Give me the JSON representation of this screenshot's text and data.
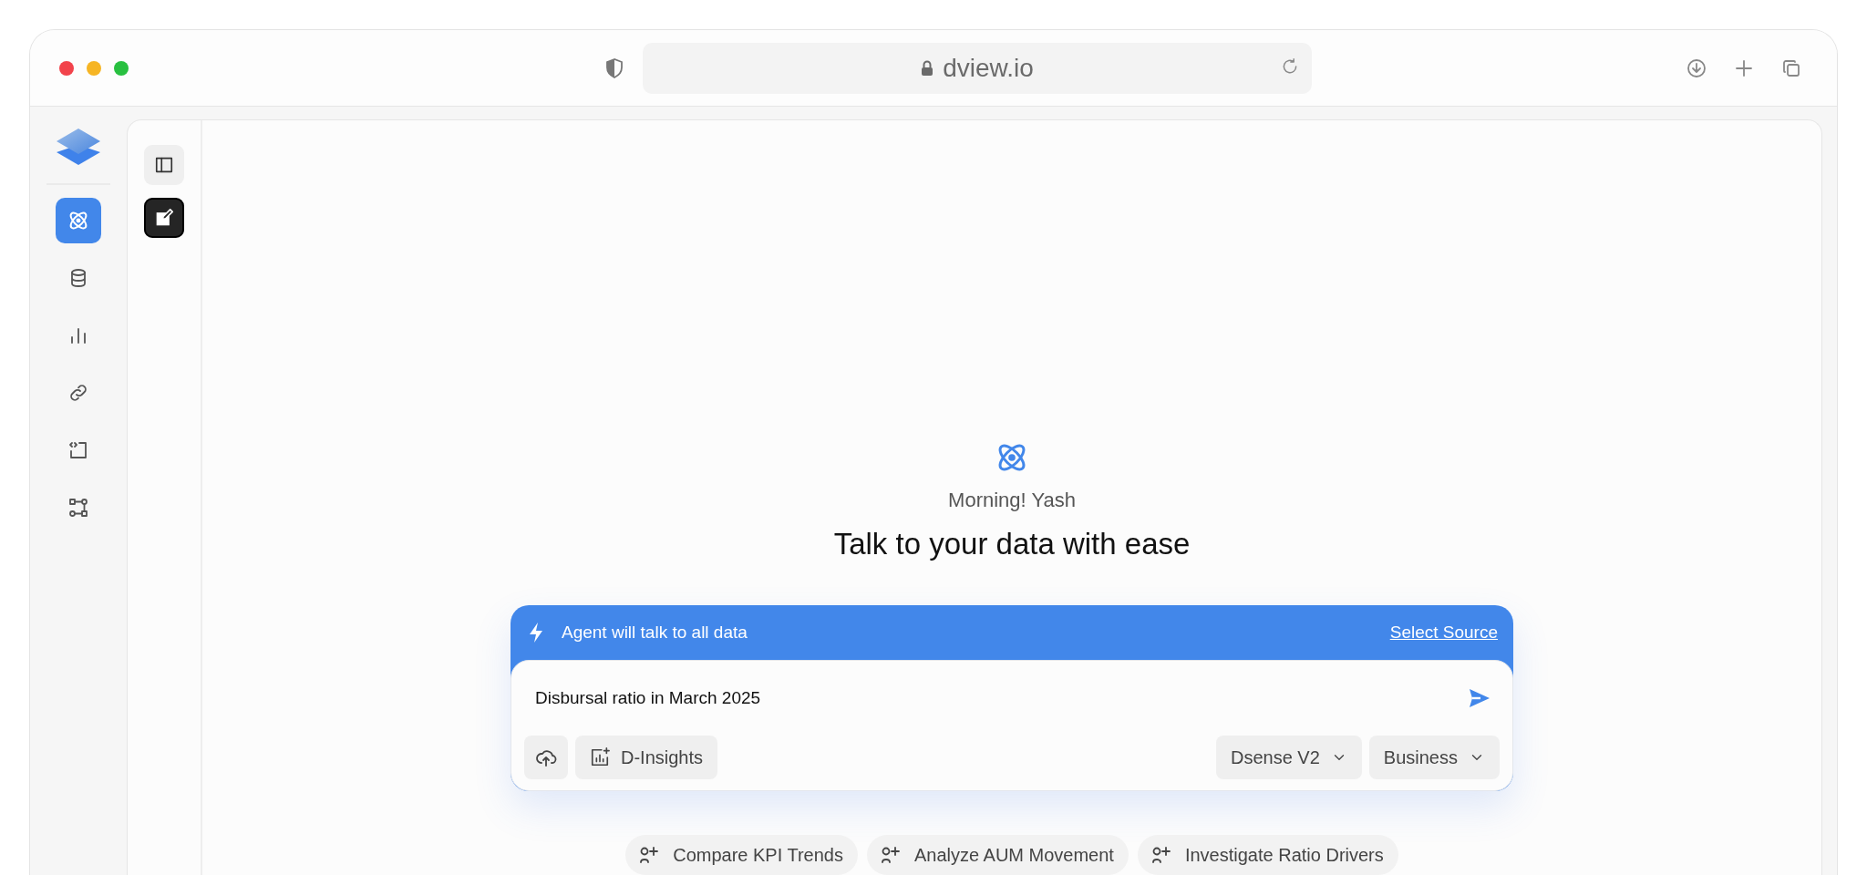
{
  "browser": {
    "url": "dview.io"
  },
  "nav": {
    "items": [
      {
        "kind": "atom",
        "selected": true
      },
      {
        "kind": "database",
        "selected": false
      },
      {
        "kind": "chart",
        "selected": false
      },
      {
        "kind": "link",
        "selected": false
      },
      {
        "kind": "code",
        "selected": false
      },
      {
        "kind": "flow",
        "selected": false
      }
    ]
  },
  "greeting": "Morning! Yash",
  "headline": "Talk to your data with ease",
  "composer": {
    "banner": "Agent will talk to all data",
    "source_link": "Select Source",
    "value": "Disbursal ratio in March 2025",
    "insights_button": "D-Insights",
    "model_select": "Dsense V2",
    "mode_select": "Business"
  },
  "suggestions": [
    "Compare KPI Trends",
    "Analyze AUM Movement",
    "Investigate Ratio Drivers"
  ]
}
